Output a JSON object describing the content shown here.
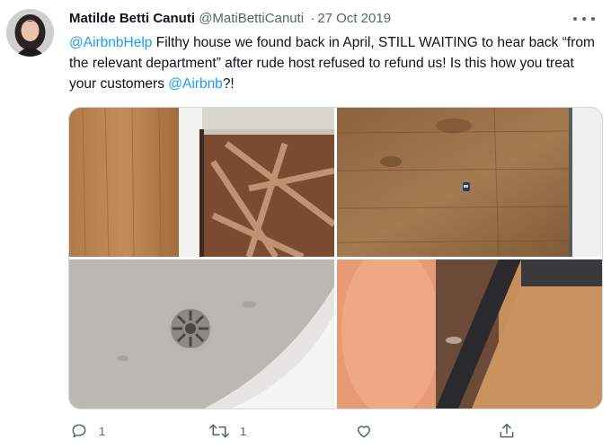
{
  "user": {
    "name": "Matilde Betti Canuti",
    "handle": "@MatiBettiCanuti",
    "separator": "·",
    "date": "27 Oct 2019"
  },
  "tweet": {
    "mention1": "@AirbnbHelp",
    "text1": " Filthy house we found back in April, STILL WAITING to hear back “from the relevant department” after rude host refused to refund us! Is this how you treat your customers ",
    "mention2": "@Airbnb",
    "text2": "?!"
  },
  "stats": {
    "replies": "1",
    "retweets": "1"
  },
  "icons": {
    "reply": "reply-icon",
    "retweet": "retweet-icon",
    "like": "heart-icon",
    "share": "share-icon",
    "more": "more-icon"
  },
  "colors": {
    "link": "#1d9bf0",
    "secondary_text": "#536471",
    "border": "#cfd9de"
  }
}
